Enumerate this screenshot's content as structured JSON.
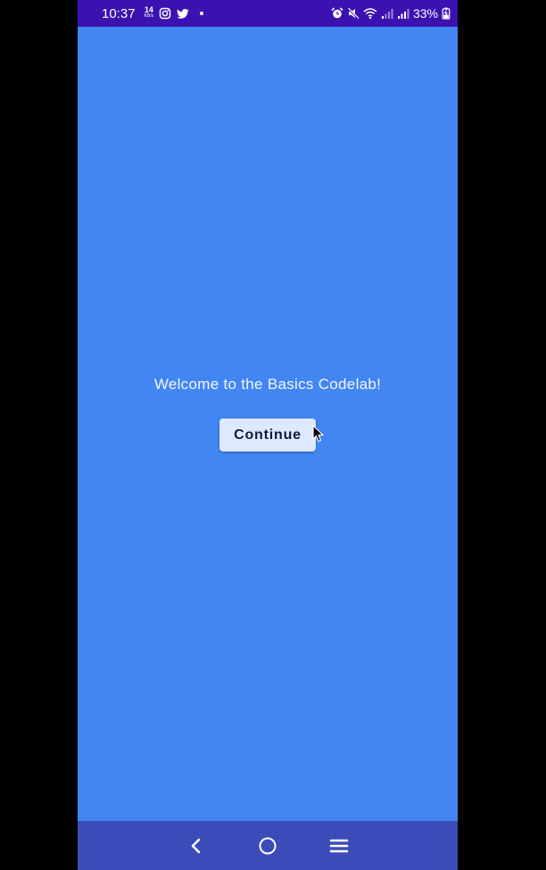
{
  "status_bar": {
    "time": "10:37",
    "net_speed_value": "14",
    "net_speed_unit": "KB/s",
    "battery_percent": "33%",
    "icons": [
      "instagram-icon",
      "twitter-icon",
      "notification-dot-icon",
      "alarm-icon",
      "mute-icon",
      "wifi-icon",
      "signal-icon",
      "signal-icon",
      "battery-icon"
    ]
  },
  "main": {
    "welcome_text": "Welcome to the Basics Codelab!",
    "continue_label": "Continue"
  },
  "nav_bar": {
    "buttons": [
      "back-icon",
      "home-icon",
      "recents-icon"
    ]
  },
  "colors": {
    "screen_background": "#4286f4",
    "status_bar": "#3b12b0",
    "nav_bar": "#3b4cb8",
    "button_background": "#dde9ff",
    "button_text": "#0c1b3d"
  }
}
